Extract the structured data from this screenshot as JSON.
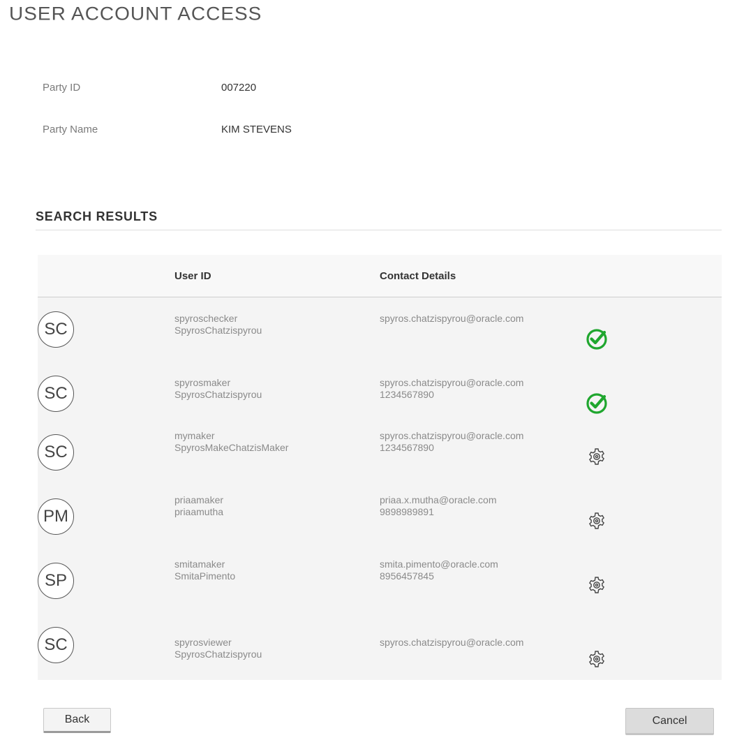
{
  "page": {
    "title": "USER ACCOUNT ACCESS"
  },
  "party": {
    "id_label": "Party ID",
    "id_value": "007220",
    "name_label": "Party Name",
    "name_value": "KIM STEVENS"
  },
  "results": {
    "heading": "SEARCH RESULTS",
    "columns": {
      "user_id": "User ID",
      "contact": "Contact Details"
    },
    "rows": [
      {
        "initials": "SC",
        "user_id": "spyroschecker",
        "user_name": "SpyrosChatzispyrou",
        "email": "spyros.chatzispyrou@oracle.com",
        "phone": "",
        "status_icon": "check-circle-icon",
        "status_color": "#1fa62e"
      },
      {
        "initials": "SC",
        "user_id": "spyrosmaker",
        "user_name": "SpyrosChatzispyrou",
        "email": "spyros.chatzispyrou@oracle.com",
        "phone": "1234567890",
        "status_icon": "check-circle-icon",
        "status_color": "#1fa62e"
      },
      {
        "initials": "SC",
        "user_id": "mymaker",
        "user_name": "SpyrosMakeChatzisMaker",
        "email": "spyros.chatzispyrou@oracle.com",
        "phone": "1234567890",
        "status_icon": "gear-icon",
        "status_color": "#444444"
      },
      {
        "initials": "PM",
        "user_id": "priaamaker",
        "user_name": "priaamutha",
        "email": "priaa.x.mutha@oracle.com",
        "phone": "9898989891",
        "status_icon": "gear-icon",
        "status_color": "#444444"
      },
      {
        "initials": "SP",
        "user_id": "smitamaker",
        "user_name": "SmitaPimento",
        "email": "smita.pimento@oracle.com",
        "phone": "8956457845",
        "status_icon": "gear-icon",
        "status_color": "#444444"
      },
      {
        "initials": "SC",
        "user_id": "spyrosviewer",
        "user_name": "SpyrosChatzispyrou",
        "email": "spyros.chatzispyrou@oracle.com",
        "phone": "",
        "status_icon": "gear-icon",
        "status_color": "#444444"
      }
    ]
  },
  "actions": {
    "back_label": "Back",
    "cancel_label": "Cancel"
  }
}
